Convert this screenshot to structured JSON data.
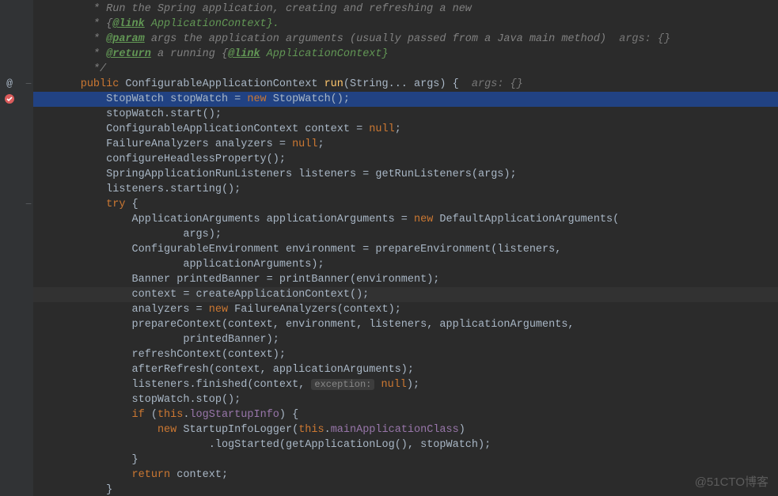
{
  "watermark": "@51CTO博客",
  "gutter": {
    "overrideMark": "@",
    "breakpointMark": "✓"
  },
  "code": {
    "doc1": " * Run the Spring application, creating and refreshing a new",
    "doc2a": " * {",
    "doc2link": "@link",
    "doc2b": " ApplicationContext}.",
    "doc3a": " * ",
    "doc3tag": "@param",
    "doc3b": " args the application arguments (usually passed from a Java main method)",
    "doc3hint": "  args: {}",
    "doc4a": " * ",
    "doc4tag": "@return",
    "doc4b": " a running {",
    "doc4link": "@link",
    "doc4c": " ApplicationContext}",
    "doc5": " */",
    "l6_kw": "public",
    "l6_type": " ConfigurableApplicationContext ",
    "l6_method": "run",
    "l6_sig": "(String... args) {",
    "l6_hint": "  args: {}",
    "l7a": "StopWatch stopWatch = ",
    "l7new": "new",
    "l7b": " StopWatch();",
    "l8": "stopWatch.start();",
    "l9a": "ConfigurableApplicationContext context = ",
    "l9null": "null",
    "l9b": ";",
    "l10a": "FailureAnalyzers analyzers = ",
    "l10null": "null",
    "l10b": ";",
    "l11": "configureHeadlessProperty();",
    "l12": "SpringApplicationRunListeners listeners = getRunListeners(args);",
    "l13": "listeners.starting();",
    "l14try": "try",
    "l14b": " {",
    "l15a": "ApplicationArguments applicationArguments = ",
    "l15new": "new",
    "l15b": " DefaultApplicationArguments(",
    "l16": "args);",
    "l17": "ConfigurableEnvironment environment = prepareEnvironment(listeners,",
    "l18": "applicationArguments);",
    "l19": "Banner printedBanner = printBanner(environment);",
    "l20": "context = createApplicationContext();",
    "l21a": "analyzers = ",
    "l21new": "new",
    "l21b": " FailureAnalyzers(context);",
    "l22": "prepareContext(context, environment, listeners, applicationArguments,",
    "l23": "printedBanner);",
    "l24": "refreshContext(context);",
    "l25": "afterRefresh(context, applicationArguments);",
    "l26a": "listeners.finished(context, ",
    "l26hint": "exception:",
    "l26null": " null",
    "l26b": ");",
    "l27": "stopWatch.stop();",
    "l28if": "if",
    "l28a": " (",
    "l28this": "this",
    "l28b": ".",
    "l28field": "logStartupInfo",
    "l28c": ") {",
    "l29new": "new",
    "l29a": " StartupInfoLogger(",
    "l29this": "this",
    "l29b": ".",
    "l29field": "mainApplicationClass",
    "l29c": ")",
    "l30": ".logStarted(getApplicationLog(), stopWatch);",
    "l31": "}",
    "l32ret": "return",
    "l32a": " context;",
    "l33": "}"
  }
}
